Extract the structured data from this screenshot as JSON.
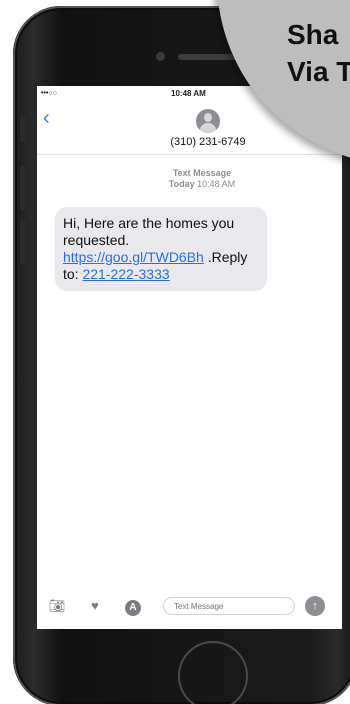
{
  "status_bar": {
    "signal": "•••○○",
    "time": "10:48 AM"
  },
  "conversation": {
    "contact": "(310) 231-6749",
    "message_kind": "Text Message",
    "message_day": "Today",
    "message_time": "10:48 AM"
  },
  "message": {
    "text_before_link": "Hi, Here are the homes you requested. ",
    "link_text": "https://goo.gl/TWD6Bh",
    "text_after_link": " .Reply to: ",
    "phone_link": "221-222-3333"
  },
  "compose": {
    "placeholder": "Text Message"
  },
  "icons": {
    "back": "chevron-left-icon",
    "avatar": "person-icon",
    "camera": "camera-icon",
    "digital_touch": "heart-icon",
    "app_store": "app-store-icon",
    "audio": "microphone-icon"
  },
  "badge": {
    "line1": "Sha",
    "line2": "Via T"
  },
  "colors": {
    "link": "#2a70d6",
    "ios_blue": "#2f7bf5",
    "bubble": "#e8e8ed",
    "badge": "#bdbdbd",
    "phone_body": "#1b1b1b"
  }
}
